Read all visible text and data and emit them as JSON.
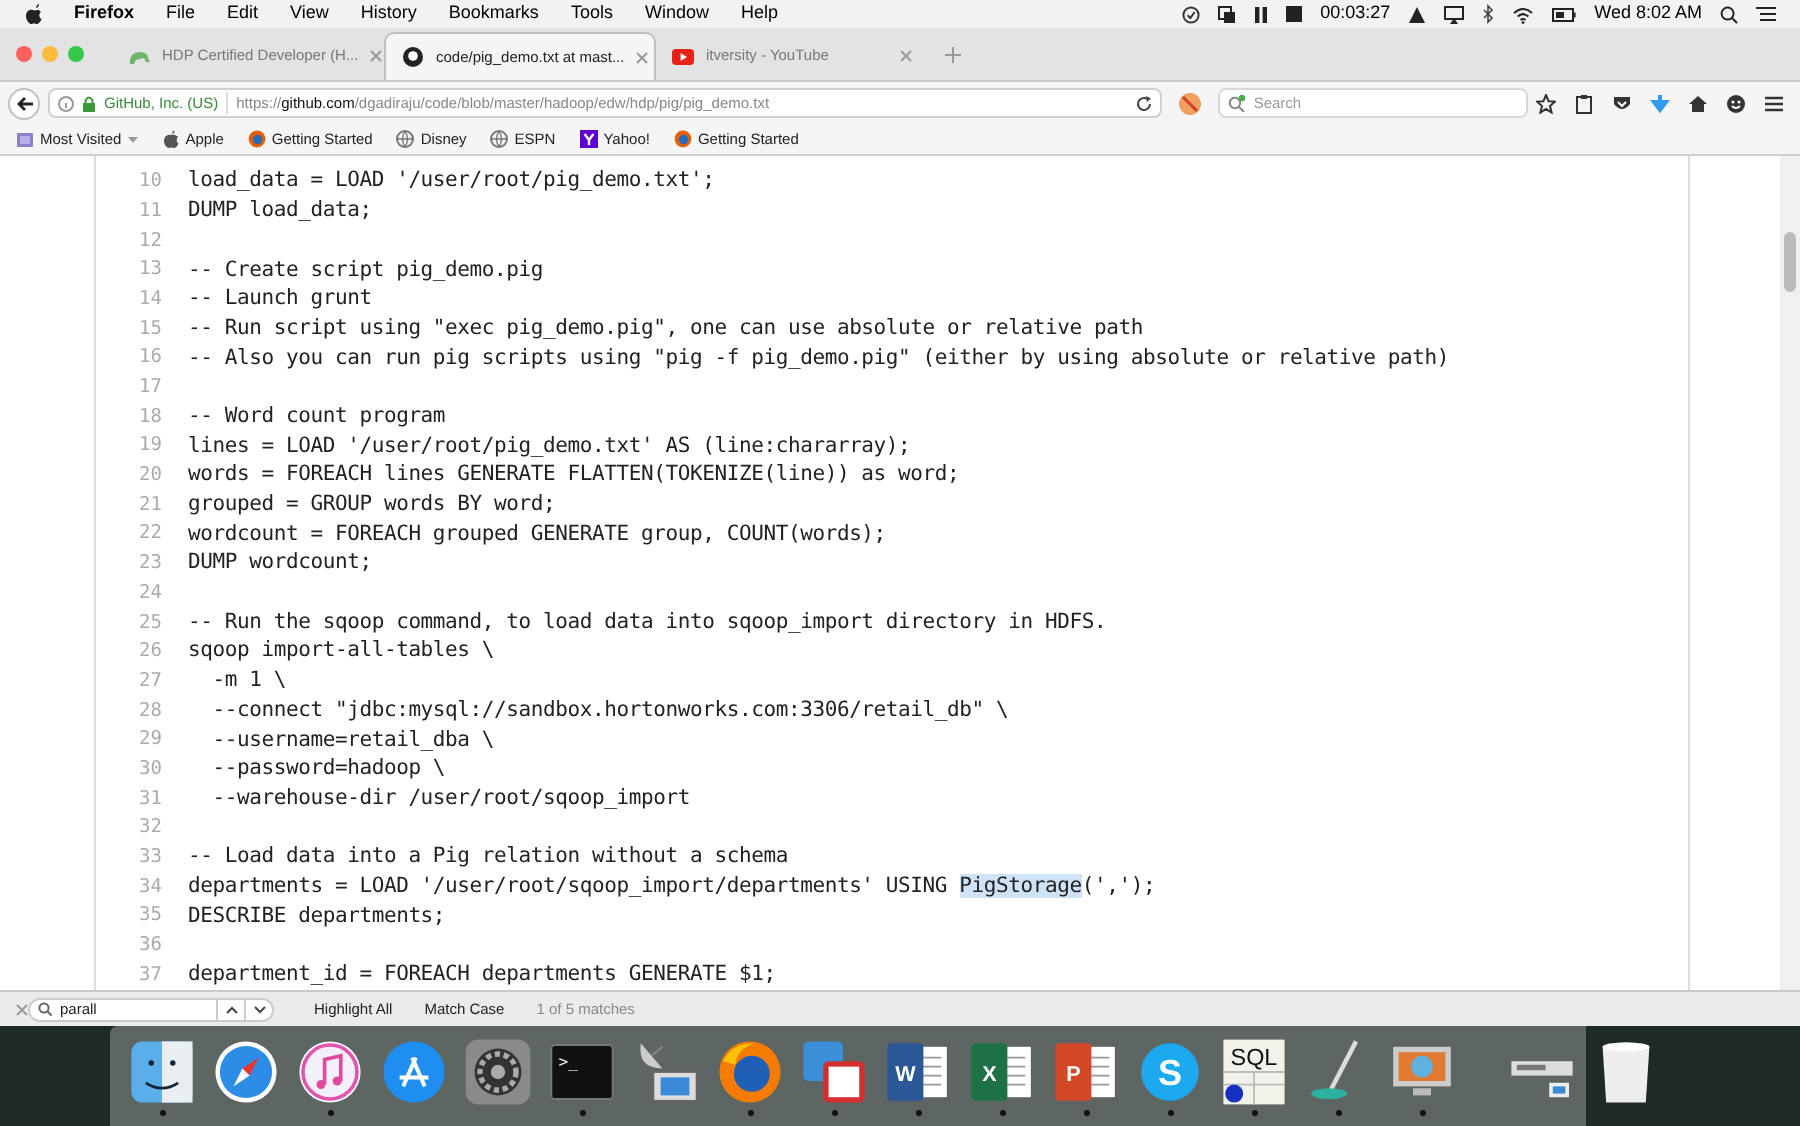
{
  "menu_bar": {
    "app": "Firefox",
    "items": [
      "File",
      "Edit",
      "View",
      "History",
      "Bookmarks",
      "Tools",
      "Window",
      "Help"
    ],
    "timer": "00:03:27",
    "clock": "Wed 8:02 AM"
  },
  "tabs": [
    {
      "kind": "hdp",
      "title": "HDP Certified Developer (H...",
      "selected": false
    },
    {
      "kind": "github",
      "title": "code/pig_demo.txt at mast...",
      "selected": true
    },
    {
      "kind": "youtube",
      "title": "itversity - YouTube",
      "selected": false
    }
  ],
  "nav": {
    "site_identity": "GitHub, Inc. (US)",
    "url_prefix": "https://",
    "url_host": "github.com",
    "url_path": "/dgadiraju/code/blob/master/hadoop/edw/hdp/pig/pig_demo.txt",
    "search_placeholder": "Search"
  },
  "bookmarks": [
    {
      "kind": "folder",
      "label": "Most Visited"
    },
    {
      "kind": "apple",
      "label": "Apple"
    },
    {
      "kind": "firefox",
      "label": "Getting Started"
    },
    {
      "kind": "globe",
      "label": "Disney"
    },
    {
      "kind": "globe",
      "label": "ESPN"
    },
    {
      "kind": "yahoo",
      "label": "Yahoo!"
    },
    {
      "kind": "firefox",
      "label": "Getting Started"
    }
  ],
  "code_lines": [
    {
      "num": "10",
      "parts": [
        {
          "text": "load_data = LOAD '/user/root/pig_demo.txt';",
          "highlighted": false
        }
      ]
    },
    {
      "num": "11",
      "parts": [
        {
          "text": "DUMP load_data;",
          "highlighted": false
        }
      ]
    },
    {
      "num": "12"
    },
    {
      "num": "13",
      "parts": [
        {
          "text": "-- Create script pig_demo.pig",
          "highlighted": false
        }
      ]
    },
    {
      "num": "14",
      "parts": [
        {
          "text": "-- Launch grunt",
          "highlighted": false
        }
      ]
    },
    {
      "num": "15",
      "parts": [
        {
          "text": "-- Run script using \"exec pig_demo.pig\", one can use absolute or relative path",
          "highlighted": false
        }
      ]
    },
    {
      "num": "16",
      "parts": [
        {
          "text": "-- Also you can run pig scripts using \"pig -f pig_demo.pig\" (either by using absolute or relative path)",
          "highlighted": false
        }
      ]
    },
    {
      "num": "17"
    },
    {
      "num": "18",
      "parts": [
        {
          "text": "-- Word count program",
          "highlighted": false
        }
      ]
    },
    {
      "num": "19",
      "parts": [
        {
          "text": "lines = LOAD '/user/root/pig_demo.txt' AS (line:chararray);",
          "highlighted": false
        }
      ]
    },
    {
      "num": "20",
      "parts": [
        {
          "text": "words = FOREACH lines GENERATE FLATTEN(TOKENIZE(line)) as word;",
          "highlighted": false
        }
      ]
    },
    {
      "num": "21",
      "parts": [
        {
          "text": "grouped = GROUP words BY word;",
          "highlighted": false
        }
      ]
    },
    {
      "num": "22",
      "parts": [
        {
          "text": "wordcount = FOREACH grouped GENERATE group, COUNT(words);",
          "highlighted": false
        }
      ]
    },
    {
      "num": "23",
      "parts": [
        {
          "text": "DUMP wordcount;",
          "highlighted": false
        }
      ]
    },
    {
      "num": "24"
    },
    {
      "num": "25",
      "parts": [
        {
          "text": "-- Run the sqoop command, to load data into sqoop_import directory in HDFS.",
          "highlighted": false
        }
      ]
    },
    {
      "num": "26",
      "parts": [
        {
          "text": "sqoop import-all-tables \\",
          "highlighted": false
        }
      ]
    },
    {
      "num": "27",
      "parts": [
        {
          "text": "  -m 1 \\",
          "highlighted": false
        }
      ]
    },
    {
      "num": "28",
      "parts": [
        {
          "text": "  --connect \"jdbc:mysql://sandbox.hortonworks.com:3306/retail_db\" \\",
          "highlighted": false
        }
      ]
    },
    {
      "num": "29",
      "parts": [
        {
          "text": "  --username=retail_dba \\",
          "highlighted": false
        }
      ]
    },
    {
      "num": "30",
      "parts": [
        {
          "text": "  --password=hadoop \\",
          "highlighted": false
        }
      ]
    },
    {
      "num": "31",
      "parts": [
        {
          "text": "  --warehouse-dir /user/root/sqoop_import",
          "highlighted": false
        }
      ]
    },
    {
      "num": "32"
    },
    {
      "num": "33",
      "parts": [
        {
          "text": "-- Load data into a Pig relation without a schema",
          "highlighted": false
        }
      ]
    },
    {
      "num": "34",
      "parts": [
        {
          "text": "departments = LOAD '/user/root/sqoop_import/departments' USING ",
          "highlighted": false
        },
        {
          "text": "PigStorage",
          "highlighted": true
        },
        {
          "text": "(',');",
          "highlighted": false
        }
      ]
    },
    {
      "num": "35",
      "parts": [
        {
          "text": "DESCRIBE departments;",
          "highlighted": false
        }
      ]
    },
    {
      "num": "36"
    },
    {
      "num": "37",
      "parts": [
        {
          "text": "department_id = FOREACH departments GENERATE $1;",
          "highlighted": false
        }
      ]
    }
  ],
  "find_bar": {
    "query": "parall",
    "highlight_all": "Highlight All",
    "match_case": "Match Case",
    "status": "1 of 5 matches"
  },
  "dock": [
    {
      "kind": "finder",
      "running": true
    },
    {
      "kind": "safari",
      "running": false
    },
    {
      "kind": "music",
      "running": true
    },
    {
      "kind": "appstore",
      "running": false
    },
    {
      "kind": "settings",
      "running": false
    },
    {
      "kind": "terminal",
      "running": true,
      "glyph": ">_"
    },
    {
      "kind": "network",
      "running": false
    },
    {
      "kind": "firefox",
      "running": true
    },
    {
      "kind": "vm",
      "running": true
    },
    {
      "kind": "doc",
      "running": true,
      "glyph": "W",
      "color": "#2b5797"
    },
    {
      "kind": "doc",
      "running": true,
      "glyph": "X",
      "color": "#1e7145"
    },
    {
      "kind": "doc",
      "running": true,
      "glyph": "P",
      "color": "#d24726"
    },
    {
      "kind": "skype",
      "running": true,
      "glyph": "S"
    },
    {
      "kind": "sql",
      "running": true,
      "glyph": "SQL"
    },
    {
      "kind": "pen",
      "running": true
    },
    {
      "kind": "video",
      "running": true
    },
    {
      "kind": "separator"
    },
    {
      "kind": "device",
      "running": false
    },
    {
      "kind": "trash",
      "running": false
    }
  ]
}
